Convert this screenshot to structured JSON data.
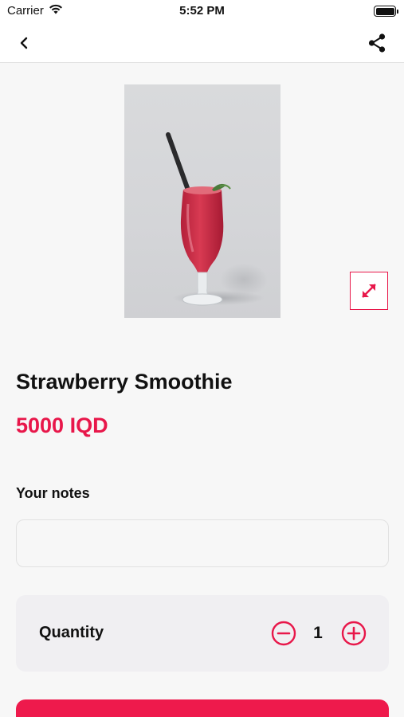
{
  "status_bar": {
    "carrier": "Carrier",
    "time": "5:52 PM"
  },
  "navbar": {
    "back_icon": "chevron-left-icon",
    "share_icon": "share-icon"
  },
  "product": {
    "name": "Strawberry Smoothie",
    "price": "5000 IQD",
    "image_alt": "Strawberry smoothie in a tall glass with a black straw"
  },
  "notes": {
    "label": "Your notes",
    "value": "",
    "placeholder": ""
  },
  "quantity": {
    "label": "Quantity",
    "value": "1"
  },
  "colors": {
    "accent": "#e8174a",
    "background": "#f7f7f7",
    "card": "#f0eff2"
  }
}
